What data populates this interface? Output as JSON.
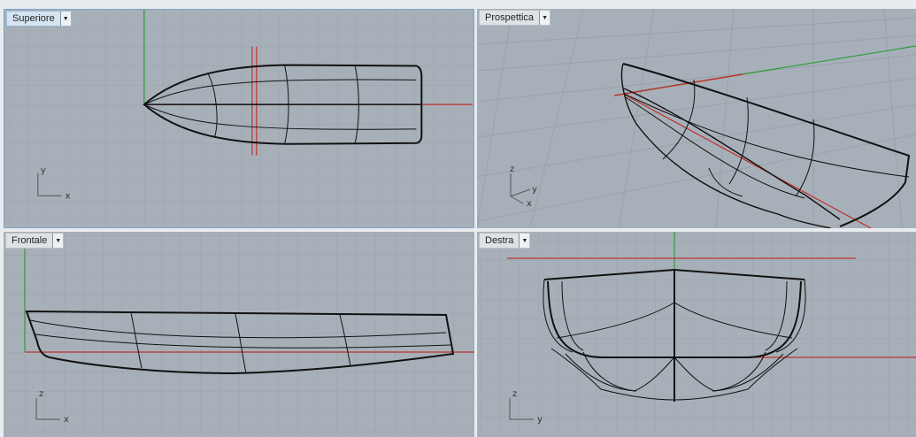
{
  "viewports": {
    "top": {
      "title": "Superiore",
      "axis_a": "y",
      "axis_b": "x"
    },
    "persp": {
      "title": "Prospettica",
      "axis_up": "z",
      "axis_a": "y",
      "axis_b": "x"
    },
    "front": {
      "title": "Frontale",
      "axis_a": "z",
      "axis_b": "x"
    },
    "right": {
      "title": "Destra",
      "axis_a": "z",
      "axis_b": "y"
    }
  },
  "active_viewport": "Superiore",
  "colors": {
    "viewport_bg": "#a7b0b8",
    "grid_minor": "#99a3ac",
    "grid_major": "#8a949d",
    "x_axis": "#c0302e",
    "y_axis": "#2f9a3a",
    "hull_curve": "#111111"
  },
  "icons": {
    "viewport_menu": "chevron-down-icon"
  }
}
